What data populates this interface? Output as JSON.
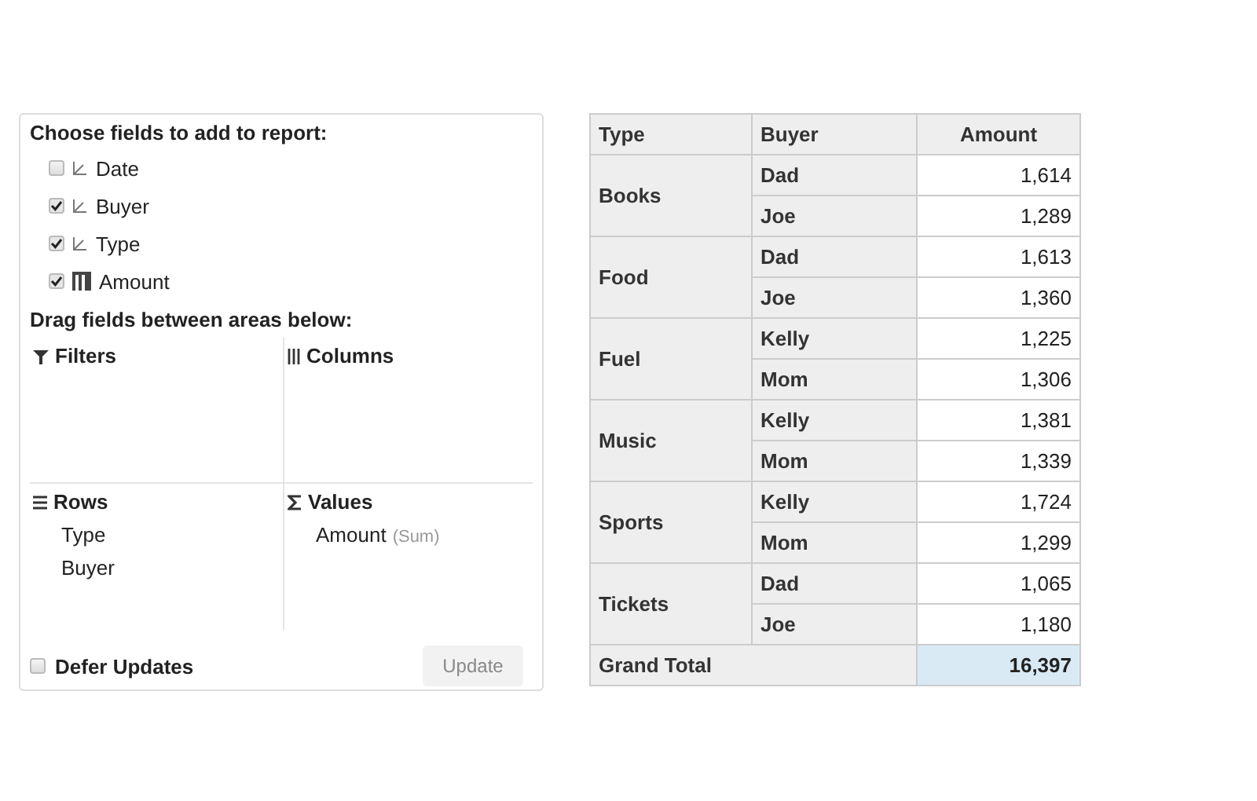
{
  "field_panel": {
    "title": "Choose fields to add to report:",
    "fields": [
      {
        "label": "Date",
        "kind": "dimension",
        "checked": false
      },
      {
        "label": "Buyer",
        "kind": "dimension",
        "checked": true
      },
      {
        "label": "Type",
        "kind": "dimension",
        "checked": true
      },
      {
        "label": "Amount",
        "kind": "measure",
        "checked": true
      }
    ],
    "areas_title": "Drag fields between areas below:",
    "areas": [
      {
        "kind": "filters",
        "title": "Filters"
      },
      {
        "kind": "columns",
        "title": "Columns"
      },
      {
        "kind": "rows",
        "title": "Rows",
        "items": [
          {
            "label": "Type"
          },
          {
            "label": "Buyer"
          }
        ]
      },
      {
        "kind": "values",
        "title": "Values",
        "items": [
          {
            "label": "Amount",
            "aggregate": "(Sum)"
          }
        ]
      }
    ],
    "defer_updates": {
      "label": "Defer Updates",
      "checked": false
    },
    "update_button": {
      "label": "Update",
      "disabled": true
    }
  },
  "pivot_table": {
    "columns": [
      "Type",
      "Buyer",
      "Amount"
    ],
    "groups": [
      {
        "type": "Books",
        "rows": [
          {
            "buyer": "Dad",
            "amount": "1,614"
          },
          {
            "buyer": "Joe",
            "amount": "1,289"
          }
        ]
      },
      {
        "type": "Food",
        "rows": [
          {
            "buyer": "Dad",
            "amount": "1,613"
          },
          {
            "buyer": "Joe",
            "amount": "1,360"
          }
        ]
      },
      {
        "type": "Fuel",
        "rows": [
          {
            "buyer": "Kelly",
            "amount": "1,225"
          },
          {
            "buyer": "Mom",
            "amount": "1,306"
          }
        ]
      },
      {
        "type": "Music",
        "rows": [
          {
            "buyer": "Kelly",
            "amount": "1,381"
          },
          {
            "buyer": "Mom",
            "amount": "1,339"
          }
        ]
      },
      {
        "type": "Sports",
        "rows": [
          {
            "buyer": "Kelly",
            "amount": "1,724"
          },
          {
            "buyer": "Mom",
            "amount": "1,299"
          }
        ]
      },
      {
        "type": "Tickets",
        "rows": [
          {
            "buyer": "Dad",
            "amount": "1,065"
          },
          {
            "buyer": "Joe",
            "amount": "1,180"
          }
        ]
      }
    ],
    "grand_total": {
      "label": "Grand Total",
      "value": "16,397",
      "selected": true
    }
  }
}
